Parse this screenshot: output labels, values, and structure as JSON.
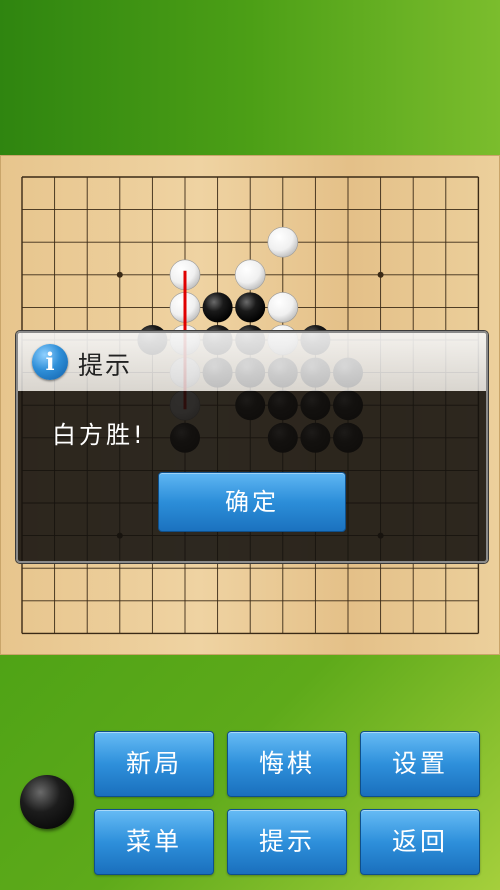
{
  "board": {
    "size": 15,
    "black_stones": [
      [
        6,
        4
      ],
      [
        7,
        4
      ],
      [
        8,
        4
      ],
      [
        4,
        5
      ],
      [
        6,
        5
      ],
      [
        7,
        5
      ],
      [
        8,
        5
      ],
      [
        9,
        5
      ],
      [
        6,
        6
      ],
      [
        7,
        6
      ],
      [
        8,
        6
      ],
      [
        9,
        6
      ],
      [
        10,
        6
      ],
      [
        5,
        7
      ],
      [
        7,
        7
      ],
      [
        8,
        7
      ],
      [
        9,
        7
      ],
      [
        10,
        7
      ],
      [
        5,
        8
      ],
      [
        8,
        8
      ],
      [
        9,
        8
      ],
      [
        10,
        8
      ]
    ],
    "white_stones": [
      [
        8,
        2
      ],
      [
        5,
        3
      ],
      [
        7,
        3
      ],
      [
        5,
        4
      ],
      [
        8,
        4
      ],
      [
        5,
        5
      ],
      [
        8,
        5
      ],
      [
        5,
        6
      ],
      [
        5,
        7
      ]
    ],
    "star_points": [
      [
        3,
        3
      ],
      [
        11,
        3
      ],
      [
        7,
        7
      ],
      [
        3,
        11
      ],
      [
        11,
        11
      ]
    ],
    "win_line": {
      "col": 5,
      "from_row": 3,
      "to_row": 7
    },
    "colors": {
      "line": "#3a2a16",
      "win_line": "#e00000"
    }
  },
  "dialog": {
    "title": "提示",
    "message": "白方胜!",
    "confirm_label": "确定"
  },
  "turn_indicator": {
    "color": "black"
  },
  "buttons": {
    "new_game": "新局",
    "undo": "悔棋",
    "settings": "设置",
    "menu": "菜单",
    "hint": "提示",
    "back": "返回"
  }
}
